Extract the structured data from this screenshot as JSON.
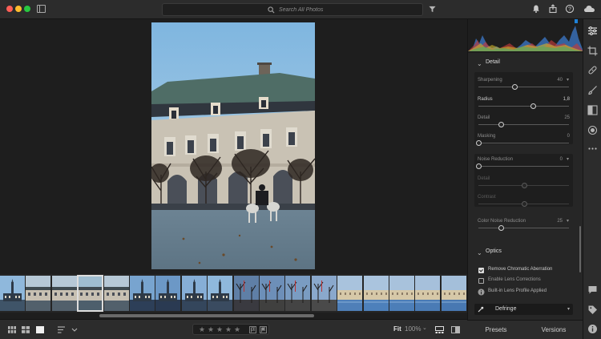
{
  "search": {
    "placeholder": "Search All Photos"
  },
  "detail": {
    "title": "Detail",
    "sharpening": {
      "label": "Sharpening",
      "value": "40",
      "level": 0.4
    },
    "radius": {
      "label": "Radius",
      "value": "1,8",
      "level": 0.6
    },
    "detail": {
      "label": "Detail",
      "value": "25",
      "level": 0.25
    },
    "masking": {
      "label": "Masking",
      "value": "0",
      "level": 0
    },
    "noise_reduction": {
      "label": "Noise Reduction",
      "value": "0",
      "level": 0
    },
    "nr_detail": {
      "label": "Detail",
      "value": "",
      "level": 0.5
    },
    "nr_contrast": {
      "label": "Contrast",
      "value": "",
      "level": 0.5
    },
    "color_noise": {
      "label": "Color Noise Reduction",
      "value": "25",
      "level": 0.25
    }
  },
  "optics": {
    "title": "Optics",
    "remove_ca": {
      "label": "Remove Chromatic Aberration",
      "checked": true
    },
    "lens_corrections": {
      "label": "Enable Lens Corrections",
      "checked": false
    },
    "profile_note": "Built-in Lens Profile Applied",
    "defringe": "Defringe"
  },
  "bottom": {
    "fit": "Fit",
    "zoom": "100%"
  },
  "rating": {
    "stars": 0,
    "max": 5
  },
  "panel_tabs": {
    "presets": "Presets",
    "versions": "Versions"
  },
  "filmstrip": {
    "selected_index": 3,
    "thumbs": [
      {
        "sky": "#8fb8dc",
        "ground": "#3f5468",
        "kind": "spire"
      },
      {
        "sky": "#b6c8d6",
        "ground": "#52606b",
        "kind": "facade"
      },
      {
        "sky": "#b6c8d6",
        "ground": "#52606b",
        "kind": "facade"
      },
      {
        "sky": "#9fbdd0",
        "ground": "#4d5f6c",
        "kind": "facade"
      },
      {
        "sky": "#b6c8d6",
        "ground": "#52606b",
        "kind": "facade"
      },
      {
        "sky": "#78a4cf",
        "ground": "#2d3f58",
        "kind": "spire"
      },
      {
        "sky": "#6c98c6",
        "ground": "#2a3a52",
        "kind": "spire"
      },
      {
        "sky": "#86aed6",
        "ground": "#34465c",
        "kind": "spire"
      },
      {
        "sky": "#8fb8dc",
        "ground": "#3a4b60",
        "kind": "spire"
      },
      {
        "sky": "#5f7fa6",
        "ground": "#3a3a40",
        "kind": "trees"
      },
      {
        "sky": "#6d8fb8",
        "ground": "#40403f",
        "kind": "trees"
      },
      {
        "sky": "#7a9cc2",
        "ground": "#444444",
        "kind": "trees"
      },
      {
        "sky": "#8aa8cc",
        "ground": "#4a4a4a",
        "kind": "trees"
      },
      {
        "sky": "#a9c3dd",
        "ground": "#4f7fb8",
        "kind": "water"
      },
      {
        "sky": "#aac4de",
        "ground": "#4d80bb",
        "kind": "water"
      },
      {
        "sky": "#a8c2dc",
        "ground": "#4c7eb8",
        "kind": "water"
      },
      {
        "sky": "#a6c0db",
        "ground": "#4a7bb5",
        "kind": "water"
      },
      {
        "sky": "#a4bfda",
        "ground": "#4878b2",
        "kind": "water"
      }
    ]
  },
  "colors": {
    "accent": "#1f82d8",
    "panel": "#262626",
    "background": "#1e1e1e"
  }
}
